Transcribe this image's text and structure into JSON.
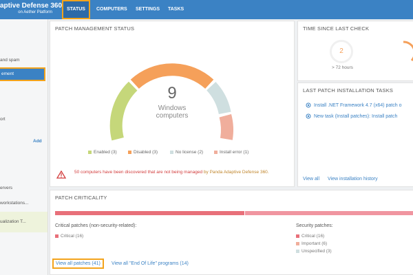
{
  "header": {
    "title": "aptive Defense 360",
    "subtitle": "on Aether Platform",
    "tabs": [
      {
        "label": "STATUS"
      },
      {
        "label": "COMPUTERS"
      },
      {
        "label": "SETTINGS"
      },
      {
        "label": "TASKS"
      }
    ]
  },
  "sidebar": {
    "items": [
      {
        "label": "and spam"
      },
      {
        "label": "ement"
      },
      {
        "label": "ort"
      },
      {
        "label": "Add"
      },
      {
        "label": "ervers"
      },
      {
        "label": "workstations..."
      },
      {
        "label": "ualization T..."
      }
    ]
  },
  "patch_status": {
    "title": "PATCH MANAGEMENT STATUS",
    "count": "9",
    "label_line1": "Windows",
    "label_line2": "computers",
    "legend": [
      {
        "label": "Enabled (3)",
        "color": "#c5d77a"
      },
      {
        "label": "Disabled (3)",
        "color": "#f5a05a"
      },
      {
        "label": "No license (2)",
        "color": "#cfdfe0"
      },
      {
        "label": "Install error (1)",
        "color": "#f0ae9c"
      }
    ],
    "warning_text": "50 computers have been discovered that are not being managed",
    "warning_link": "by Panda Adaptive Defense 360."
  },
  "time_check": {
    "title": "TIME SINCE LAST CHECK",
    "value": "2",
    "caption": "> 72 hours"
  },
  "last_tasks": {
    "title": "LAST PATCH INSTALLATION TASKS",
    "tasks": [
      {
        "label": "Install .NET Framework 4.7 (x64) patch o"
      },
      {
        "label": "New task (Install patches): Install patch"
      }
    ],
    "view_all": "View all",
    "view_history": "View installation history"
  },
  "criticality": {
    "title": "PATCH CRITICALITY",
    "critical_title": "Critical patches (non-security-related):",
    "critical_items": [
      {
        "label": "Critical (16)",
        "color": "#e8707a"
      }
    ],
    "security_title": "Security patches:",
    "security_items": [
      {
        "label": "Critical (16)",
        "color": "#e8707a"
      },
      {
        "label": "Important (6)",
        "color": "#f0ae9c"
      },
      {
        "label": "Unspecified (3)",
        "color": "#cfdfe0"
      }
    ],
    "view_all_patches": "View all patches (41)",
    "view_eol": "View all \"End Of Life\" programs (14)"
  }
}
